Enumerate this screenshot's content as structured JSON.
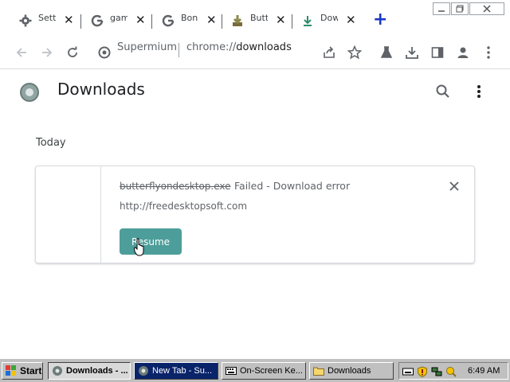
{
  "tabs": [
    {
      "label": "Setti",
      "icon": "gear-icon"
    },
    {
      "label": "game",
      "icon": "google-icon"
    },
    {
      "label": "Bona",
      "icon": "google-icon"
    },
    {
      "label": "Butte",
      "icon": "download-app-icon"
    },
    {
      "label": "Dow",
      "icon": "download-icon"
    }
  ],
  "toolbar": {
    "site_label": "Supermium",
    "url_scheme": "chrome://",
    "url_path": "downloads"
  },
  "page": {
    "title": "Downloads",
    "section": "Today"
  },
  "download": {
    "file_name": "butterflyondesktop.exe",
    "status": "Failed - Download error",
    "url": "http://freedesktopsoft.com",
    "resume_label": "Resume"
  },
  "taskbar": {
    "start_label": "Start",
    "items": [
      {
        "label": "Downloads - ..."
      },
      {
        "label": "New Tab - Su..."
      },
      {
        "label": "On-Screen Ke..."
      },
      {
        "label": "Downloads"
      }
    ],
    "clock": "6:49 AM"
  },
  "colors": {
    "accent": "#4d9e9a",
    "taskbar": "#c0c0c0",
    "selected_task": "#0a246a"
  }
}
